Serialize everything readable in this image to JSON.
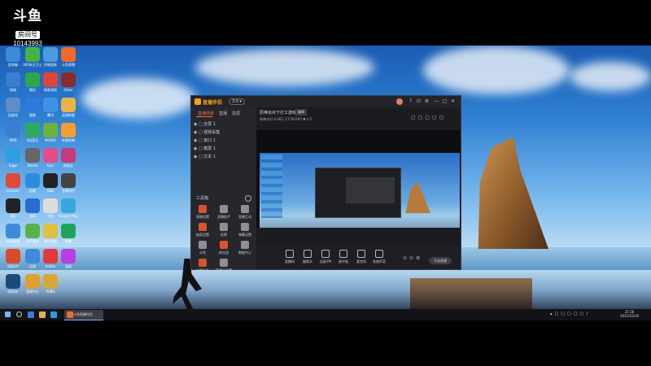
{
  "watermark": {
    "logo": "斗鱼",
    "tag": "房间号",
    "room": "10143993"
  },
  "desktop_icons": [
    {
      "label": "此电脑",
      "color": "#3b8bd9"
    },
    {
      "label": "360安全卫士",
      "color": "#44b347"
    },
    {
      "label": "控制面板",
      "color": "#4a9ee0"
    },
    {
      "label": "斗鱼直播",
      "color": "#f06a2a"
    },
    {
      "label": "网络",
      "color": "#3a7ed0"
    },
    {
      "label": "微信",
      "color": "#2ea64f"
    },
    {
      "label": "网易游戏",
      "color": "#e0443a"
    },
    {
      "label": "Elden",
      "color": "#8a2c2c"
    },
    {
      "label": "回收站",
      "color": "#5d8ec8"
    },
    {
      "label": "酷狗",
      "color": "#2b7be0"
    },
    {
      "label": "腾讯",
      "color": "#3c94e5"
    },
    {
      "label": "英雄联盟",
      "color": "#e8b34a"
    },
    {
      "label": "WPS",
      "color": "#3a7ed0"
    },
    {
      "label": "QQ音乐",
      "color": "#2eaa5a"
    },
    {
      "label": "NVIDIA",
      "color": "#6bb33a"
    },
    {
      "label": "哔哩哔哩",
      "color": "#f0a030"
    },
    {
      "label": "Edge",
      "color": "#2d9fe0"
    },
    {
      "label": "Steam",
      "color": "#666"
    },
    {
      "label": "Epic",
      "color": "#e64c86"
    },
    {
      "label": "网易云",
      "color": "#c43a7b"
    },
    {
      "label": "Chrome",
      "color": "#e2483a"
    },
    {
      "label": "迅雷",
      "color": "#2c8de0"
    },
    {
      "label": "OBS",
      "color": "#222"
    },
    {
      "label": "直播伴侣",
      "color": "#444"
    },
    {
      "label": "QQ",
      "color": "#222"
    },
    {
      "label": "战网",
      "color": "#2a6cd0"
    },
    {
      "label": "文档",
      "color": "#dddddd"
    },
    {
      "label": "Google Play",
      "color": "#38a8dc"
    },
    {
      "label": "UU加速器",
      "color": "#3b8bd9"
    },
    {
      "label": "360游戏",
      "color": "#5ab04a"
    },
    {
      "label": "腾讯游戏",
      "color": "#e0c040"
    },
    {
      "label": "剪映",
      "color": "#1ca35e"
    },
    {
      "label": "网易UU",
      "color": "#d94a2a"
    },
    {
      "label": "迅游",
      "color": "#3b8bd9"
    },
    {
      "label": "Adobe",
      "color": "#e03a3a"
    },
    {
      "label": "画图",
      "color": "#b840e0"
    },
    {
      "label": "Steam",
      "color": "#1b4a7a"
    },
    {
      "label": "游戏中心",
      "color": "#e0a030"
    },
    {
      "label": "PUBG",
      "color": "#d6a838"
    }
  ],
  "app": {
    "name": "直播伴侣",
    "version": "3.0 ▾",
    "window_controls": [
      "?",
      "⊡",
      "⚙",
      "—",
      "□",
      "✕"
    ],
    "sidebar_tabs": [
      {
        "label": "直播场景",
        "active": true
      },
      {
        "label": "直播",
        "active": false
      },
      {
        "label": "投屏",
        "active": false
      }
    ],
    "scenes": [
      "全屏 1",
      "视频采集",
      "窗口 1",
      "截屏 1",
      "文本 1"
    ],
    "tools_title": "工具箱",
    "tools": [
      {
        "label": "直播设置",
        "gray": false
      },
      {
        "label": "直播助手",
        "gray": true
      },
      {
        "label": "直播互动",
        "gray": true
      },
      {
        "label": "抽奖设置",
        "gray": false
      },
      {
        "label": "投票",
        "gray": true
      },
      {
        "label": "弹幕设置",
        "gray": true
      },
      {
        "label": "分享",
        "gray": true
      },
      {
        "label": "粉丝团",
        "gray": false
      },
      {
        "label": "数据中心",
        "gray": true
      },
      {
        "label": "主播任务",
        "gray": false
      },
      {
        "label": "直播间设置",
        "gray": true
      }
    ],
    "room_title": "原神派对下打工游戏",
    "edit_label": "编辑",
    "stats": "原神派对  4.08万  11784393  ♥ 4.5",
    "bottom_buttons": [
      "直播间",
      "摄像头",
      "连麦/PK",
      "画中画",
      "麦克风",
      "系统声音"
    ],
    "start_live": "开始直播"
  },
  "taskbar": {
    "app_label": "斗鱼直播伴侣",
    "time": "21:56",
    "date": "2021/03/10"
  }
}
